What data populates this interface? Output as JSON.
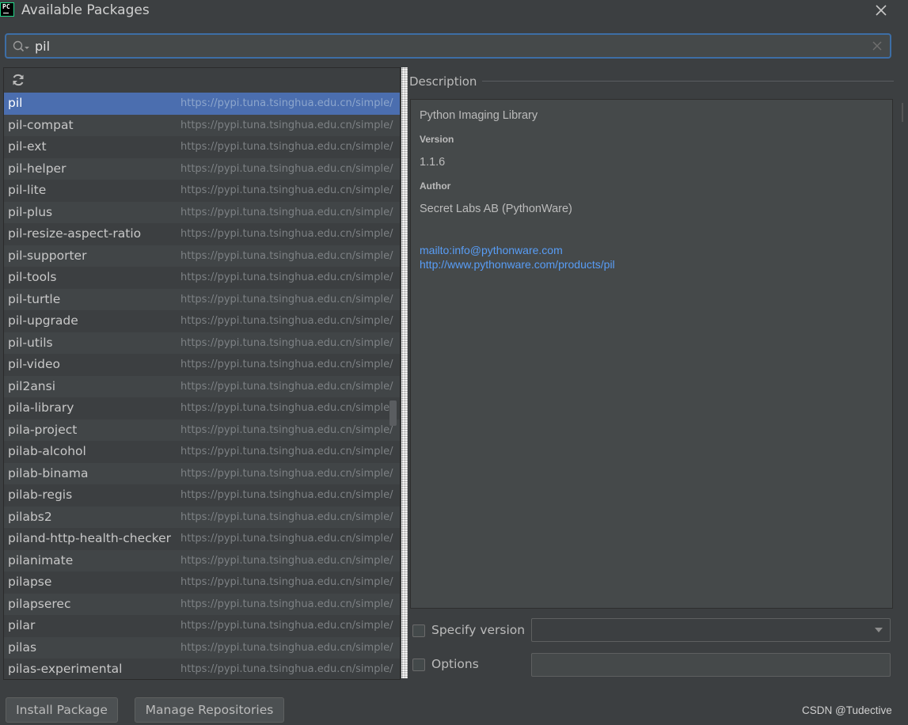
{
  "window": {
    "title": "Available Packages",
    "icon_text": "PC"
  },
  "search": {
    "value": "pil",
    "placeholder": ""
  },
  "packages": [
    {
      "name": "pil",
      "url": "https://pypi.tuna.tsinghua.edu.cn/simple/",
      "selected": true
    },
    {
      "name": "pil-compat",
      "url": "https://pypi.tuna.tsinghua.edu.cn/simple/"
    },
    {
      "name": "pil-ext",
      "url": "https://pypi.tuna.tsinghua.edu.cn/simple/"
    },
    {
      "name": "pil-helper",
      "url": "https://pypi.tuna.tsinghua.edu.cn/simple/"
    },
    {
      "name": "pil-lite",
      "url": "https://pypi.tuna.tsinghua.edu.cn/simple/"
    },
    {
      "name": "pil-plus",
      "url": "https://pypi.tuna.tsinghua.edu.cn/simple/"
    },
    {
      "name": "pil-resize-aspect-ratio",
      "url": "https://pypi.tuna.tsinghua.edu.cn/simple/"
    },
    {
      "name": "pil-supporter",
      "url": "https://pypi.tuna.tsinghua.edu.cn/simple/"
    },
    {
      "name": "pil-tools",
      "url": "https://pypi.tuna.tsinghua.edu.cn/simple/"
    },
    {
      "name": "pil-turtle",
      "url": "https://pypi.tuna.tsinghua.edu.cn/simple/"
    },
    {
      "name": "pil-upgrade",
      "url": "https://pypi.tuna.tsinghua.edu.cn/simple/"
    },
    {
      "name": "pil-utils",
      "url": "https://pypi.tuna.tsinghua.edu.cn/simple/"
    },
    {
      "name": "pil-video",
      "url": "https://pypi.tuna.tsinghua.edu.cn/simple/"
    },
    {
      "name": "pil2ansi",
      "url": "https://pypi.tuna.tsinghua.edu.cn/simple/"
    },
    {
      "name": "pila-library",
      "url": "https://pypi.tuna.tsinghua.edu.cn/simple/"
    },
    {
      "name": "pila-project",
      "url": "https://pypi.tuna.tsinghua.edu.cn/simple/"
    },
    {
      "name": "pilab-alcohol",
      "url": "https://pypi.tuna.tsinghua.edu.cn/simple/"
    },
    {
      "name": "pilab-binama",
      "url": "https://pypi.tuna.tsinghua.edu.cn/simple/"
    },
    {
      "name": "pilab-regis",
      "url": "https://pypi.tuna.tsinghua.edu.cn/simple/"
    },
    {
      "name": "pilabs2",
      "url": "https://pypi.tuna.tsinghua.edu.cn/simple/"
    },
    {
      "name": "piland-http-health-checker",
      "url": "https://pypi.tuna.tsinghua.edu.cn/simple/"
    },
    {
      "name": "pilanimate",
      "url": "https://pypi.tuna.tsinghua.edu.cn/simple/"
    },
    {
      "name": "pilapse",
      "url": "https://pypi.tuna.tsinghua.edu.cn/simple/"
    },
    {
      "name": "pilapserec",
      "url": "https://pypi.tuna.tsinghua.edu.cn/simple/"
    },
    {
      "name": "pilar",
      "url": "https://pypi.tuna.tsinghua.edu.cn/simple/"
    },
    {
      "name": "pilas",
      "url": "https://pypi.tuna.tsinghua.edu.cn/simple/"
    },
    {
      "name": "pilas-experimental",
      "url": "https://pypi.tuna.tsinghua.edu.cn/simple/"
    }
  ],
  "description": {
    "heading": "Description",
    "summary": "Python Imaging Library",
    "version_label": "Version",
    "version": "1.1.6",
    "author_label": "Author",
    "author": "Secret Labs AB (PythonWare)",
    "email_link": "mailto:info@pythonware.com",
    "homepage_link": "http://www.pythonware.com/products/pil"
  },
  "options": {
    "specify_version_label": "Specify version",
    "specify_version_checked": false,
    "options_label": "Options",
    "options_checked": false,
    "version_value": "",
    "options_value": ""
  },
  "buttons": {
    "install": "Install Package",
    "manage": "Manage Repositories"
  },
  "watermark": "CSDN @Tudective",
  "colors": {
    "accent": "#4b6eaf",
    "link": "#589df6",
    "background": "#3c3f41",
    "focus_border": "#3d6ea6"
  }
}
